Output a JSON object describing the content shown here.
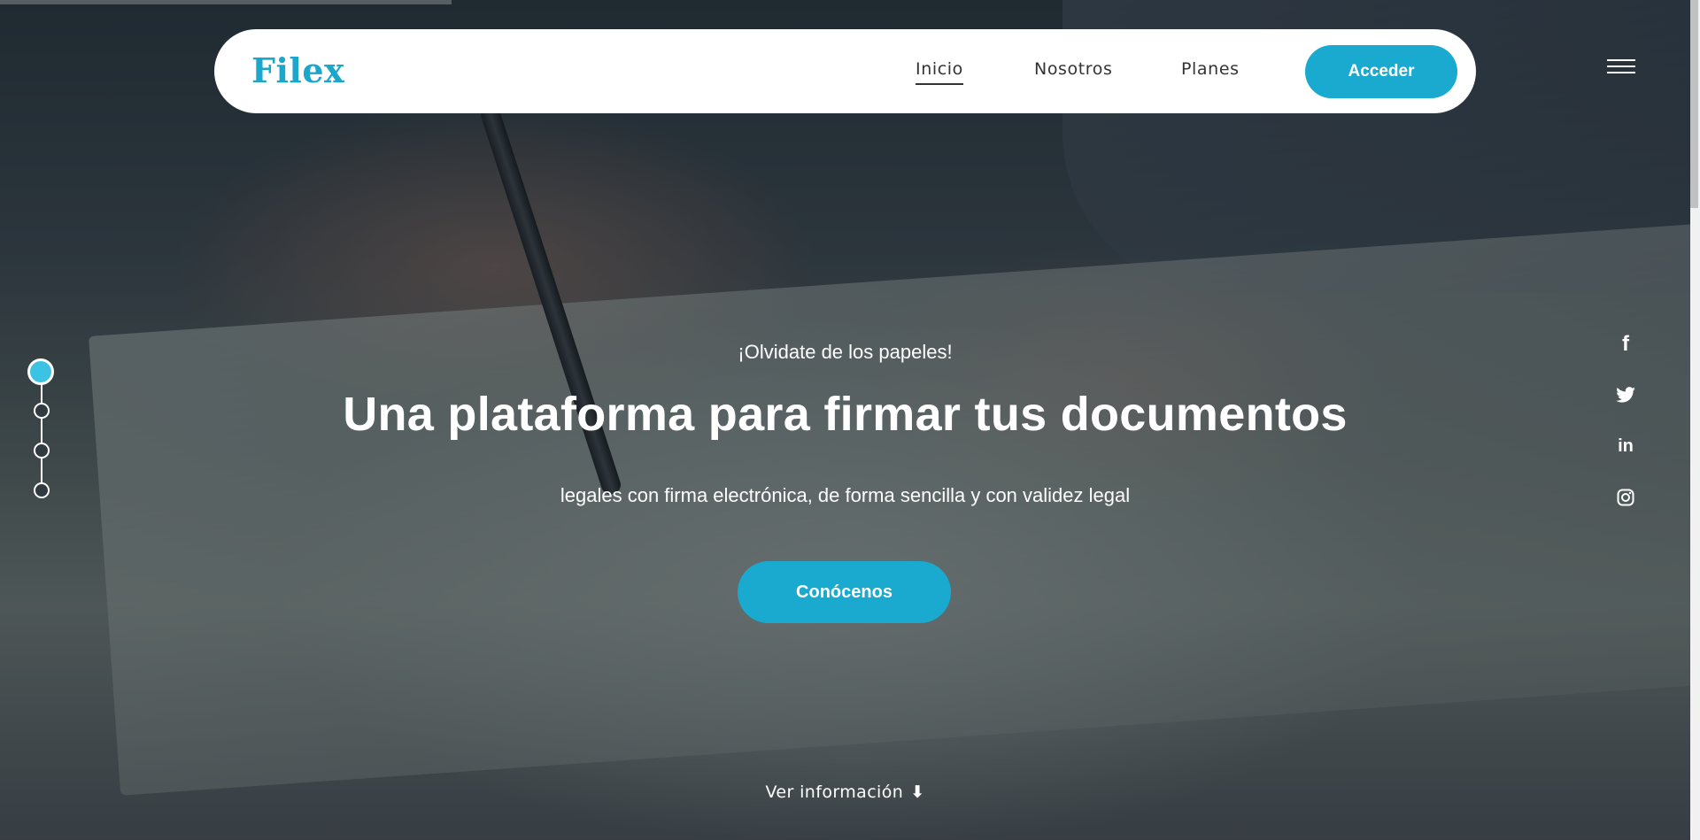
{
  "navbar": {
    "logo": "Filex",
    "links": [
      {
        "label": "Inicio",
        "active": true
      },
      {
        "label": "Nosotros",
        "active": false
      },
      {
        "label": "Planes",
        "active": false
      }
    ],
    "cta_label": "Acceder"
  },
  "hero": {
    "eyebrow": "¡Olvidate de los papeles!",
    "headline": "Una plataforma para firmar tus documentos",
    "subline": "legales con firma electrónica, de forma sencilla y con validez legal",
    "cta_label": "Conócenos",
    "scroll_label": "Ver información",
    "scroll_arrow": "⬇"
  },
  "steps": {
    "count": 4,
    "active_index": 0
  },
  "social": [
    {
      "icon": "facebook-icon",
      "glyph": "f"
    },
    {
      "icon": "twitter-icon"
    },
    {
      "icon": "linkedin-icon",
      "glyph": "in"
    },
    {
      "icon": "instagram-icon"
    }
  ],
  "colors": {
    "accent": "#1aa9cf",
    "logo": "#1ba6cb",
    "active_step": "#3cc3e3",
    "navbar_bg": "#ffffff",
    "text_light": "#ffffff"
  }
}
